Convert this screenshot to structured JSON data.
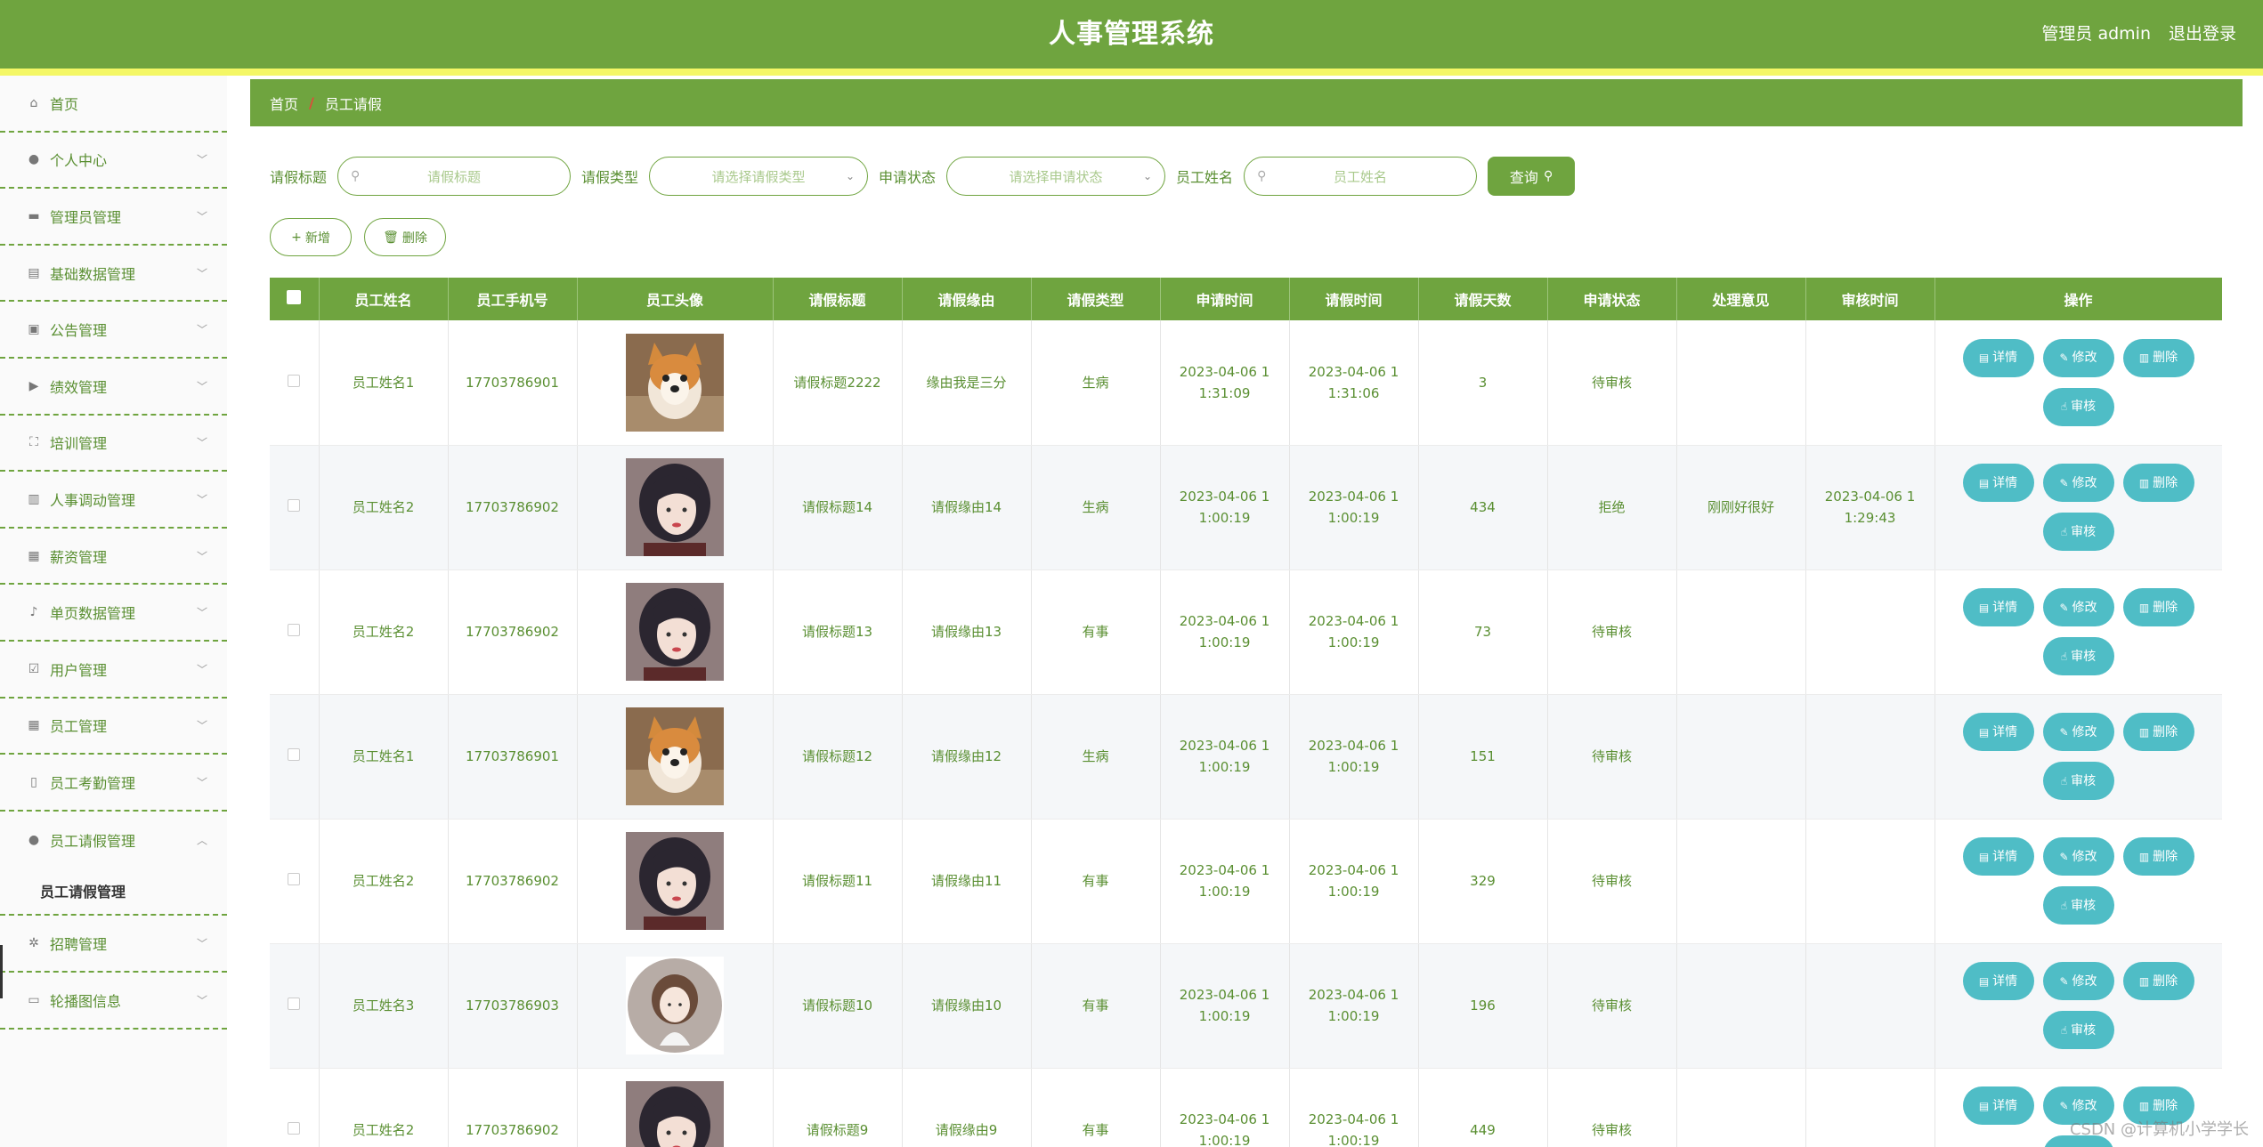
{
  "header": {
    "title": "人事管理系统",
    "user": "管理员 admin",
    "logout": "退出登录"
  },
  "sidebar": {
    "items": [
      {
        "label": "首页",
        "icon": "home-icon",
        "chevron": false
      },
      {
        "label": "个人中心",
        "icon": "user-icon",
        "chevron": true
      },
      {
        "label": "管理员管理",
        "icon": "briefcase-icon",
        "chevron": true
      },
      {
        "label": "基础数据管理",
        "icon": "chart-icon",
        "chevron": true
      },
      {
        "label": "公告管理",
        "icon": "clipboard-icon",
        "chevron": true
      },
      {
        "label": "绩效管理",
        "icon": "video-icon",
        "chevron": true
      },
      {
        "label": "培训管理",
        "icon": "fullscreen-icon",
        "chevron": true
      },
      {
        "label": "人事调动管理",
        "icon": "books-icon",
        "chevron": true
      },
      {
        "label": "薪资管理",
        "icon": "keyboard-icon",
        "chevron": true
      },
      {
        "label": "单页数据管理",
        "icon": "mic-icon",
        "chevron": true
      },
      {
        "label": "用户管理",
        "icon": "checklist-icon",
        "chevron": true
      },
      {
        "label": "员工管理",
        "icon": "grid-icon",
        "chevron": true
      },
      {
        "label": "员工考勤管理",
        "icon": "mobile-icon",
        "chevron": true
      },
      {
        "label": "员工请假管理",
        "icon": "location-icon",
        "chevron": true,
        "expanded": true,
        "sub": "员工请假管理"
      },
      {
        "label": "招聘管理",
        "icon": "compass-icon",
        "chevron": true
      },
      {
        "label": "轮播图信息",
        "icon": "chat-icon",
        "chevron": true
      }
    ]
  },
  "breadcrumb": {
    "home": "首页",
    "separator": "/",
    "current": "员工请假"
  },
  "search": {
    "title_label": "请假标题",
    "title_placeholder": "请假标题",
    "type_label": "请假类型",
    "type_placeholder": "请选择请假类型",
    "status_label": "申请状态",
    "status_placeholder": "请选择申请状态",
    "name_label": "员工姓名",
    "name_placeholder": "员工姓名",
    "query_label": "查询"
  },
  "actions": {
    "add": "新增",
    "delete": "删除"
  },
  "table": {
    "headers": [
      "员工姓名",
      "员工手机号",
      "员工头像",
      "请假标题",
      "请假缘由",
      "请假类型",
      "申请时间",
      "请假时间",
      "请假天数",
      "申请状态",
      "处理意见",
      "审核时间",
      "操作"
    ],
    "rows": [
      {
        "name": "员工姓名1",
        "phone": "17703786901",
        "avatar": "dog",
        "title": "请假标题2222",
        "reason": "缘由我是三分",
        "type": "生病",
        "apply_time": "2023-04-06 11:31:09",
        "leave_time": "2023-04-06 11:31:06",
        "days": "3",
        "status": "待审核",
        "opinion": "",
        "review_time": ""
      },
      {
        "name": "员工姓名2",
        "phone": "17703786902",
        "avatar": "girl",
        "title": "请假标题14",
        "reason": "请假缘由14",
        "type": "生病",
        "apply_time": "2023-04-06 11:00:19",
        "leave_time": "2023-04-06 11:00:19",
        "days": "434",
        "status": "拒绝",
        "opinion": "刚刚好很好",
        "review_time": "2023-04-06 11:29:43"
      },
      {
        "name": "员工姓名2",
        "phone": "17703786902",
        "avatar": "girl",
        "title": "请假标题13",
        "reason": "请假缘由13",
        "type": "有事",
        "apply_time": "2023-04-06 11:00:19",
        "leave_time": "2023-04-06 11:00:19",
        "days": "73",
        "status": "待审核",
        "opinion": "",
        "review_time": ""
      },
      {
        "name": "员工姓名1",
        "phone": "17703786901",
        "avatar": "dog",
        "title": "请假标题12",
        "reason": "请假缘由12",
        "type": "生病",
        "apply_time": "2023-04-06 11:00:19",
        "leave_time": "2023-04-06 11:00:19",
        "days": "151",
        "status": "待审核",
        "opinion": "",
        "review_time": ""
      },
      {
        "name": "员工姓名2",
        "phone": "17703786902",
        "avatar": "girl",
        "title": "请假标题11",
        "reason": "请假缘由11",
        "type": "有事",
        "apply_time": "2023-04-06 11:00:19",
        "leave_time": "2023-04-06 11:00:19",
        "days": "329",
        "status": "待审核",
        "opinion": "",
        "review_time": ""
      },
      {
        "name": "员工姓名3",
        "phone": "17703786903",
        "avatar": "cartoon",
        "title": "请假标题10",
        "reason": "请假缘由10",
        "type": "有事",
        "apply_time": "2023-04-06 11:00:19",
        "leave_time": "2023-04-06 11:00:19",
        "days": "196",
        "status": "待审核",
        "opinion": "",
        "review_time": ""
      },
      {
        "name": "员工姓名2",
        "phone": "17703786902",
        "avatar": "girl",
        "title": "请假标题9",
        "reason": "请假缘由9",
        "type": "有事",
        "apply_time": "2023-04-06 11:00:19",
        "leave_time": "2023-04-06 11:00:19",
        "days": "449",
        "status": "待审核",
        "opinion": "",
        "review_time": ""
      }
    ],
    "row_buttons": {
      "detail": "详情",
      "edit": "修改",
      "delete": "删除",
      "review": "审核"
    }
  },
  "watermark": "CSDN @计算机小学学长",
  "colors": {
    "primary": "#6fa43f",
    "accent_stripe": "#f4f766",
    "row_button": "#4fbdc6"
  }
}
